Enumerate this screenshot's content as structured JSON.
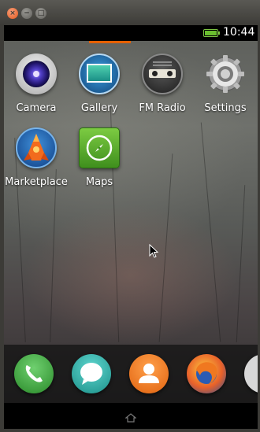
{
  "window": {
    "close_glyph": "×",
    "minimize_glyph": "−",
    "maximize_glyph": "□"
  },
  "status": {
    "time": "10:44",
    "battery_color": "#6abf2e"
  },
  "accent_color": "#e66000",
  "apps": [
    {
      "label": "Camera",
      "icon": "camera-icon"
    },
    {
      "label": "Gallery",
      "icon": "gallery-icon"
    },
    {
      "label": "FM Radio",
      "icon": "fm-radio-icon"
    },
    {
      "label": "Settings",
      "icon": "settings-icon"
    },
    {
      "label": "Marketplace",
      "icon": "marketplace-icon"
    },
    {
      "label": "Maps",
      "icon": "maps-icon"
    }
  ],
  "dock": [
    {
      "icon": "phone-icon",
      "color": "#3aa33a"
    },
    {
      "icon": "messages-icon",
      "color": "#2bb0a8"
    },
    {
      "icon": "contacts-icon",
      "color": "#f07a1e"
    },
    {
      "icon": "browser-icon",
      "color": "#e8612a"
    }
  ],
  "navbar": {
    "home_icon": "home-icon"
  }
}
